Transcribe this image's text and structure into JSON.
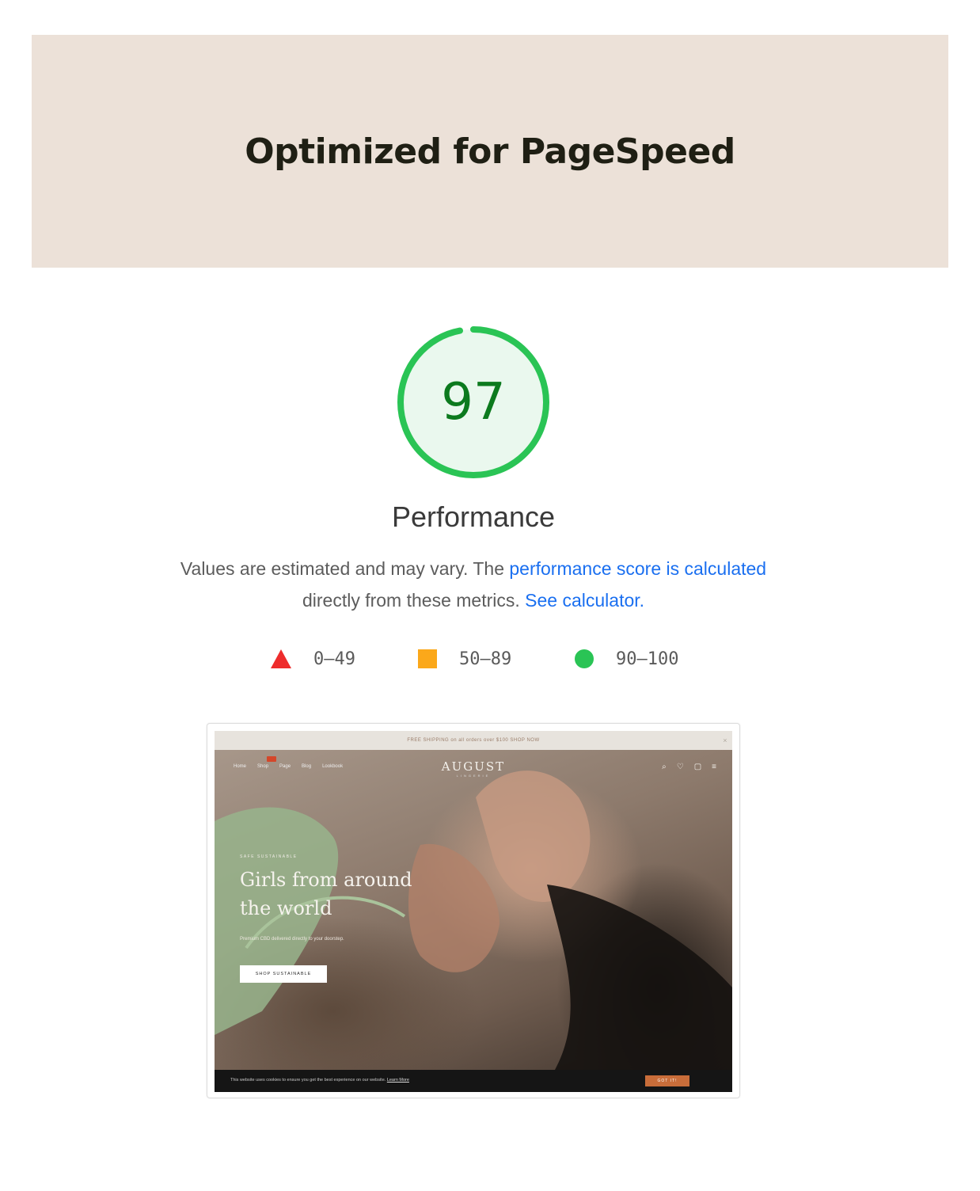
{
  "header": {
    "title": "Optimized for PageSpeed"
  },
  "score": {
    "value": "97",
    "fraction": 0.97,
    "label": "Performance"
  },
  "description": {
    "text_before": "Values are estimated and may vary. The ",
    "link1": "performance score is calculated",
    "text_middle": "directly from these metrics. ",
    "link2": "See calculator."
  },
  "legend": {
    "items": [
      {
        "label": "0–49",
        "shape": "triangle-icon",
        "color": "#ee2c2c"
      },
      {
        "label": "50–89",
        "shape": "square-icon",
        "color": "#fba81a"
      },
      {
        "label": "90–100",
        "shape": "circle-icon",
        "color": "#2ac455"
      }
    ]
  },
  "screenshot": {
    "announcement": "FREE SHIPPING on all orders over $100 SHOP NOW",
    "nav": [
      "Home",
      "Shop",
      "Page",
      "Blog",
      "Lookbook"
    ],
    "brand": "AUGUST",
    "brand_sub": "LINGERIE",
    "eyebrow": "SAFE SUSTAINABLE",
    "headline": "Girls from around the world",
    "subtext": "Premium CBD delivered directly to your doorstep.",
    "cta": "SHOP SUSTAINABLE",
    "cookie_text": "This website uses cookies to ensure you get the best experience on our website.",
    "cookie_link": "Learn More",
    "cookie_button": "GOT IT!"
  },
  "colors": {
    "hero_bg": "#ece1d8",
    "gauge_green": "#2ac455",
    "gauge_fill": "#eaf8ee",
    "score_text": "#0c7a1e",
    "link": "#1a6ff0"
  }
}
